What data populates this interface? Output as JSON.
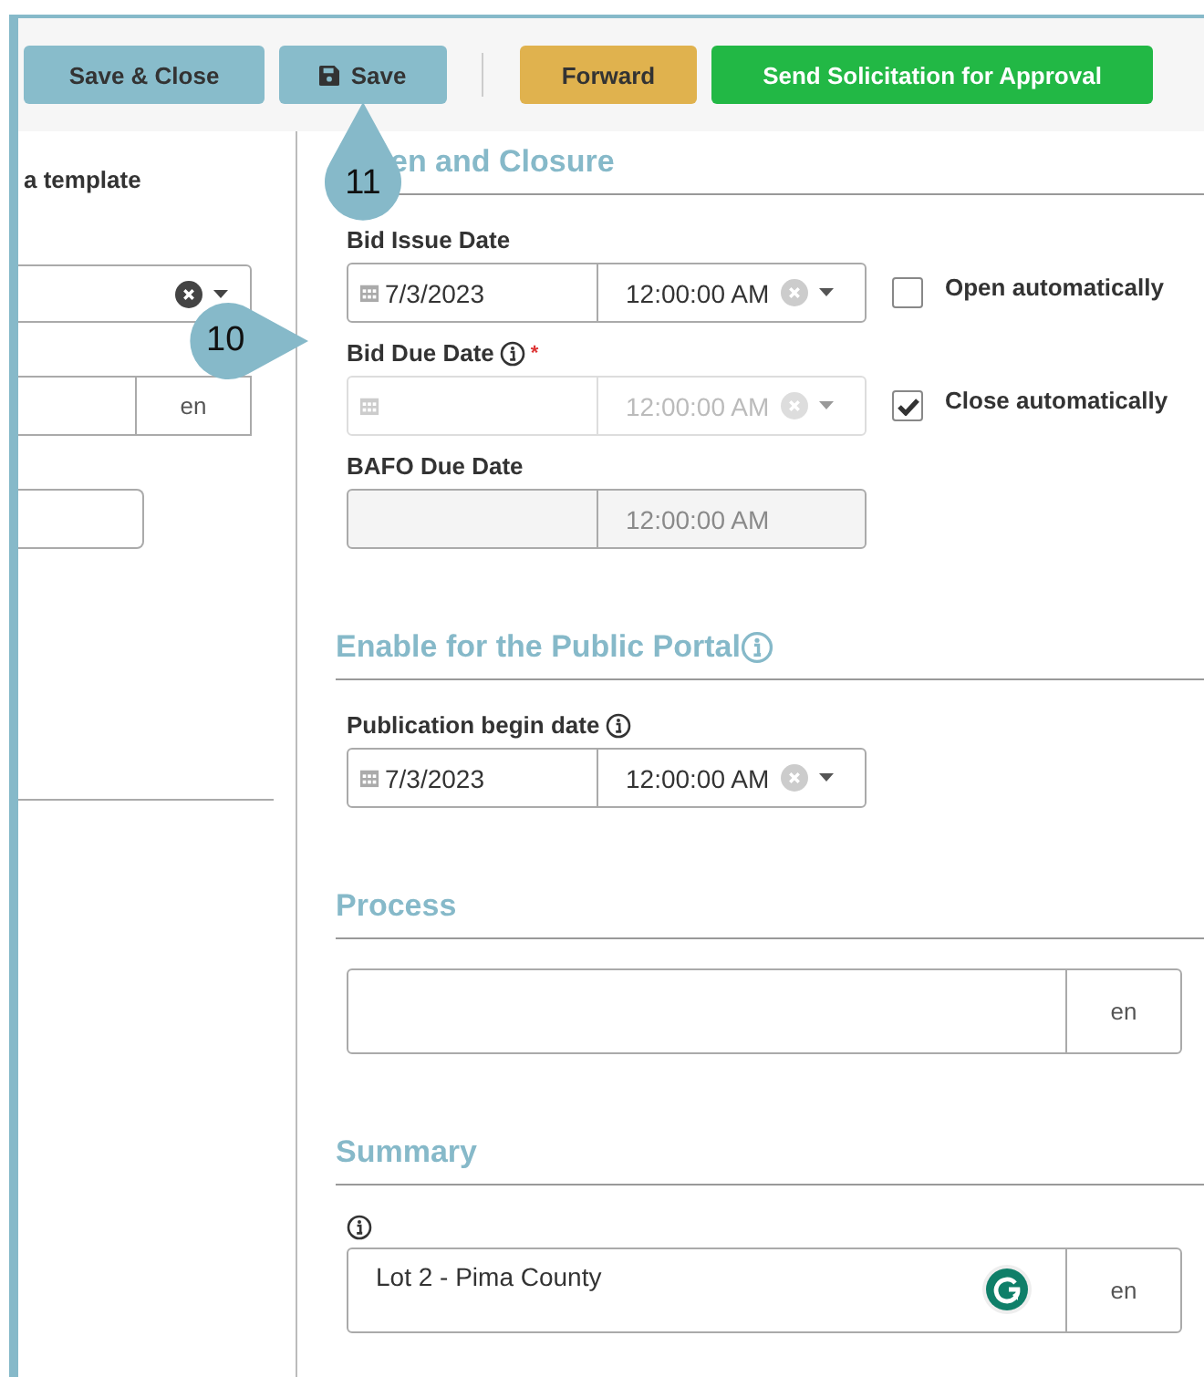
{
  "toolbar": {
    "buttons": [
      {
        "label": "Save & Close",
        "kind": "plain"
      },
      {
        "label": "Save",
        "kind": "save"
      },
      {
        "label": "Forward",
        "kind": "warning"
      },
      {
        "label": "Send Solicitation for Approval",
        "kind": "success"
      }
    ]
  },
  "left_panel": {
    "label": "a template",
    "fields": [
      {
        "kind": "select",
        "clearable": true
      },
      {
        "kind": "text",
        "language": "en"
      },
      {
        "kind": "box"
      }
    ]
  },
  "callouts": [
    {
      "number": "11"
    },
    {
      "number": "10"
    }
  ],
  "sections": [
    {
      "title": "en and Closure",
      "info": false,
      "kind": "dates",
      "rows": [
        {
          "kind": "picker",
          "label": "Bid Issue Date",
          "info": false,
          "date": "7/3/2023",
          "time": "12:00:00 AM",
          "disabled": false,
          "checkbox": {
            "label": "Open automatically",
            "checked": false
          }
        },
        {
          "kind": "picker",
          "label": "Bid Due Date",
          "info": true,
          "required_mark": "*",
          "time": "12:00:00 AM",
          "disabled": true,
          "checkbox": {
            "label": "Close automatically",
            "checked": true
          }
        },
        {
          "kind": "readonly",
          "label": "BAFO Due Date",
          "info": false,
          "time": "12:00:00 AM"
        }
      ]
    },
    {
      "title": "Enable for the Public Portal",
      "info": true,
      "kind": "dates",
      "rows": [
        {
          "kind": "picker",
          "label": "Publication begin date",
          "info": true,
          "date": "7/3/2023",
          "time": "12:00:00 AM",
          "disabled": false
        }
      ]
    },
    {
      "title": "Process",
      "info": false,
      "kind": "text",
      "field": {
        "info": false,
        "grammar_badge": false,
        "language": "en"
      }
    },
    {
      "title": "Summary",
      "info": false,
      "kind": "text",
      "field": {
        "info": true,
        "value": "Lot 2 - Pima County",
        "grammar_badge": true,
        "language": "en"
      }
    }
  ]
}
